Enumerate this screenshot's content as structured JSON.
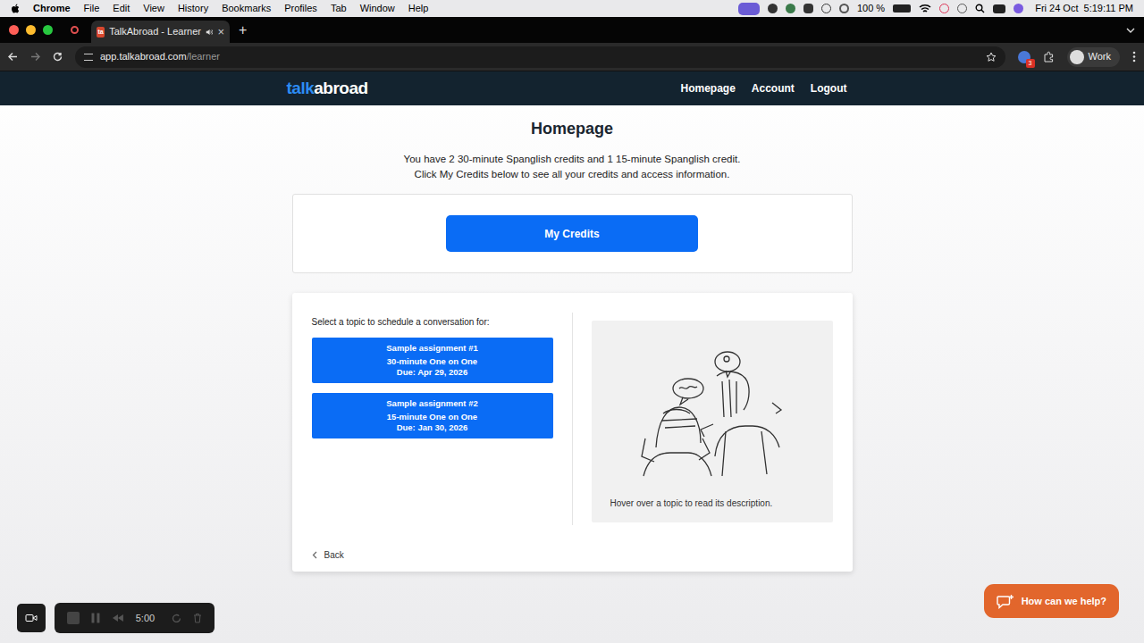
{
  "menu_bar": {
    "app": "Chrome",
    "items": [
      "File",
      "Edit",
      "View",
      "History",
      "Bookmarks",
      "Profiles",
      "Tab",
      "Window",
      "Help"
    ],
    "battery": "100 %",
    "clock": "Fri 24 Oct  5:19:11 PM"
  },
  "browser": {
    "tab": {
      "favicon": "ta",
      "title": "TalkAbroad - Learner",
      "close": "×",
      "selected": true
    },
    "new_tab": "+",
    "url": {
      "host": "app.talkabroad.com",
      "path": "/learner"
    },
    "extension_badge": "3",
    "profile": "Work"
  },
  "navbar": {
    "logo": {
      "first": "talk",
      "second": "abroad"
    },
    "links": [
      "Homepage",
      "Account",
      "Logout"
    ]
  },
  "page": {
    "heading": "Homepage",
    "credits_lines": [
      "You have 2 30-minute Spanglish credits and 1 15-minute Spanglish credit.",
      "Click My Credits below to see all your credits and access information."
    ],
    "credits_button": "My Credits",
    "topics_prompt": "Select a topic to schedule a conversation for:",
    "assignments": [
      {
        "title": "Sample assignment #1",
        "type": "30-minute One on One",
        "due": "Due: Apr 29, 2026"
      },
      {
        "title": "Sample assignment #2",
        "type": "15-minute One on One",
        "due": "Due: Jan 30, 2026"
      }
    ],
    "description_hint": "Hover over a topic to read its description.",
    "back": "Back"
  },
  "recorder": {
    "time": "5:00"
  },
  "help_button": "How can we help?"
}
